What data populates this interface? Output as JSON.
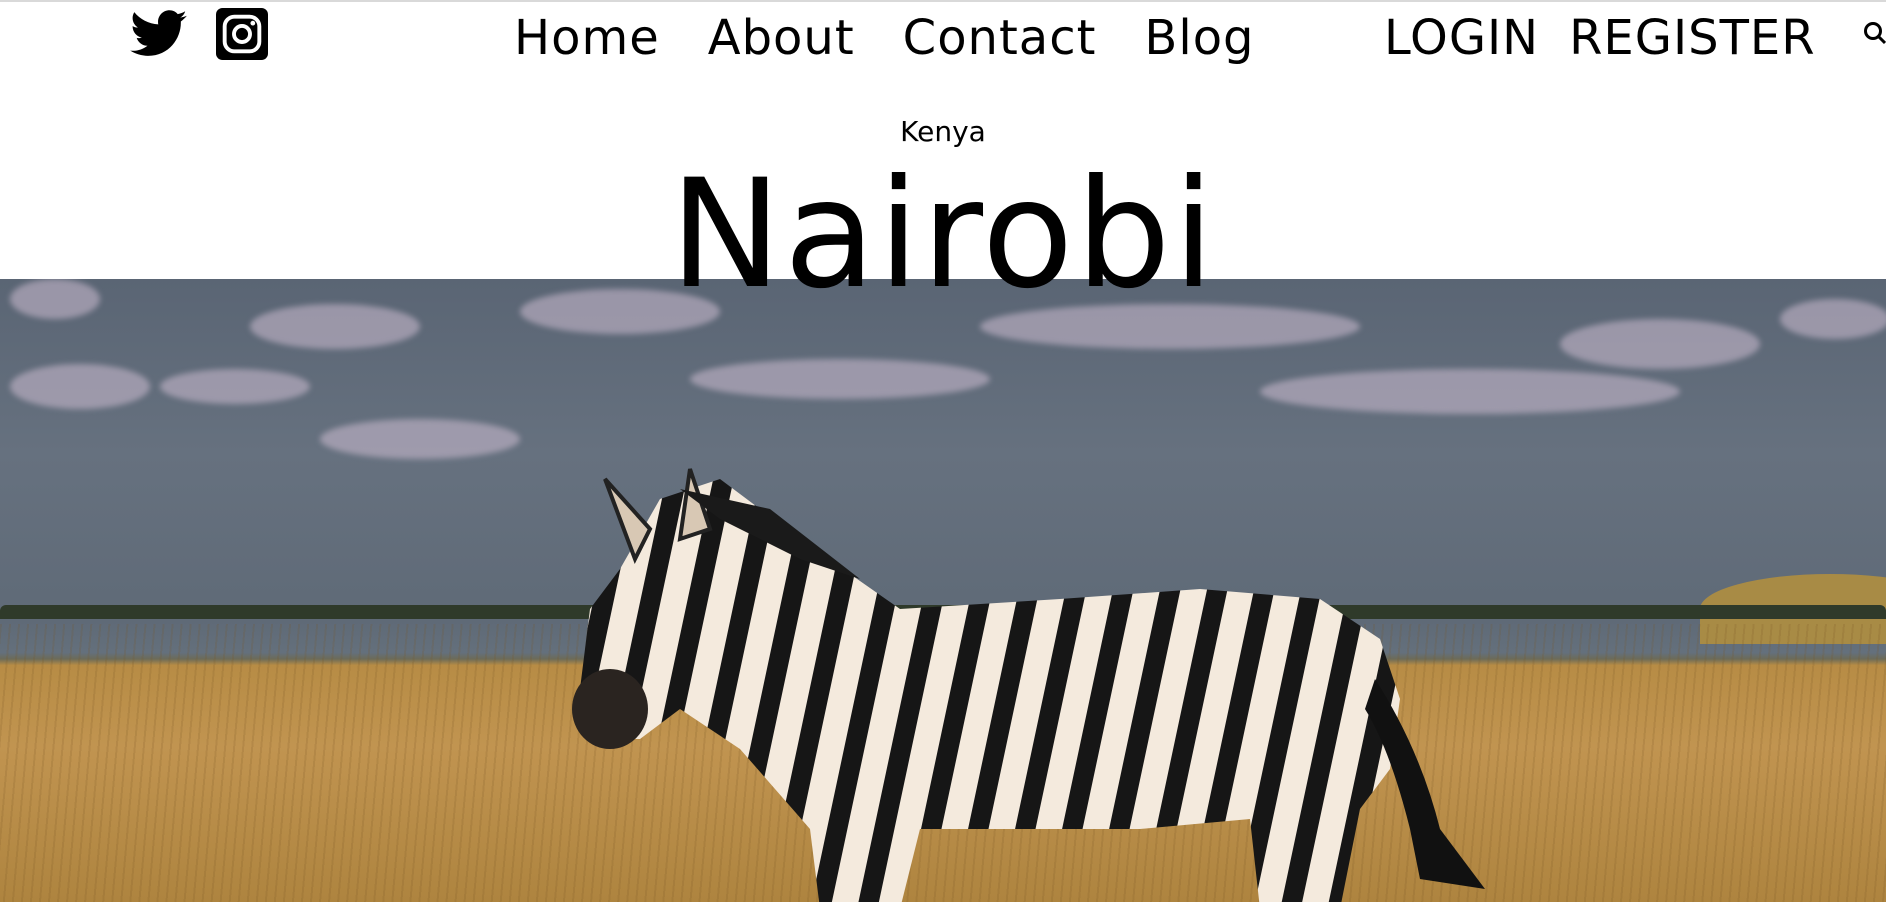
{
  "header": {
    "social": [
      {
        "name": "twitter-icon"
      },
      {
        "name": "instagram-icon"
      }
    ],
    "nav": [
      {
        "label": "Home"
      },
      {
        "label": "About"
      },
      {
        "label": "Contact"
      },
      {
        "label": "Blog"
      }
    ],
    "auth": {
      "login": "LOGIN",
      "register": "REGISTER"
    },
    "search_icon": "search-icon"
  },
  "title": {
    "country": "Kenya",
    "city": "Nairobi"
  },
  "hero": {
    "image": "zebra-in-grassland"
  },
  "colors": {
    "text": "#000000",
    "sky": "#5f6a77",
    "grass": "#c19450"
  }
}
